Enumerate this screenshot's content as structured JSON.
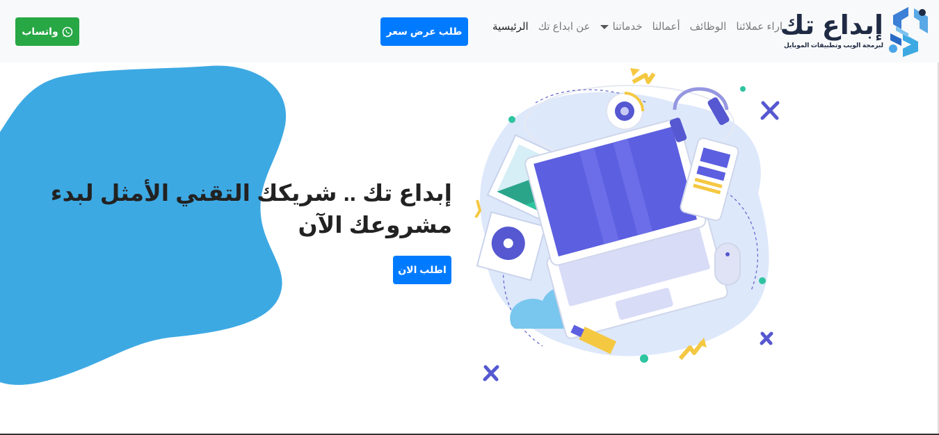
{
  "brand": {
    "name": "إبداع تك",
    "tagline": "لبرمجة الويب وتطبيقات الموبايل"
  },
  "nav": {
    "items": [
      {
        "label": "الرئيسية",
        "active": true
      },
      {
        "label": "عن ابداع تك",
        "active": false
      },
      {
        "label": "خدماتنا",
        "active": false,
        "dropdown": true
      },
      {
        "label": "أعمالنا",
        "active": false
      },
      {
        "label": "الوظائف",
        "active": false
      },
      {
        "label": "اراء عملائنا",
        "active": false
      }
    ],
    "quote_button": "طلب عرض سعر",
    "whatsapp_button": "واتساب"
  },
  "hero": {
    "title": "إبداع تك .. شريكك التقني الأمثل لبدء مشروعك الآن",
    "cta_button": "اطلب الان"
  },
  "colors": {
    "primary": "#007bff",
    "whatsapp": "#28a745",
    "blob": "#3da9e3",
    "navbar_bg": "#f8f9fa"
  },
  "icons": {
    "logo": "brand-logo-icon",
    "whatsapp": "whatsapp-icon",
    "dropdown": "caret-down-icon"
  }
}
